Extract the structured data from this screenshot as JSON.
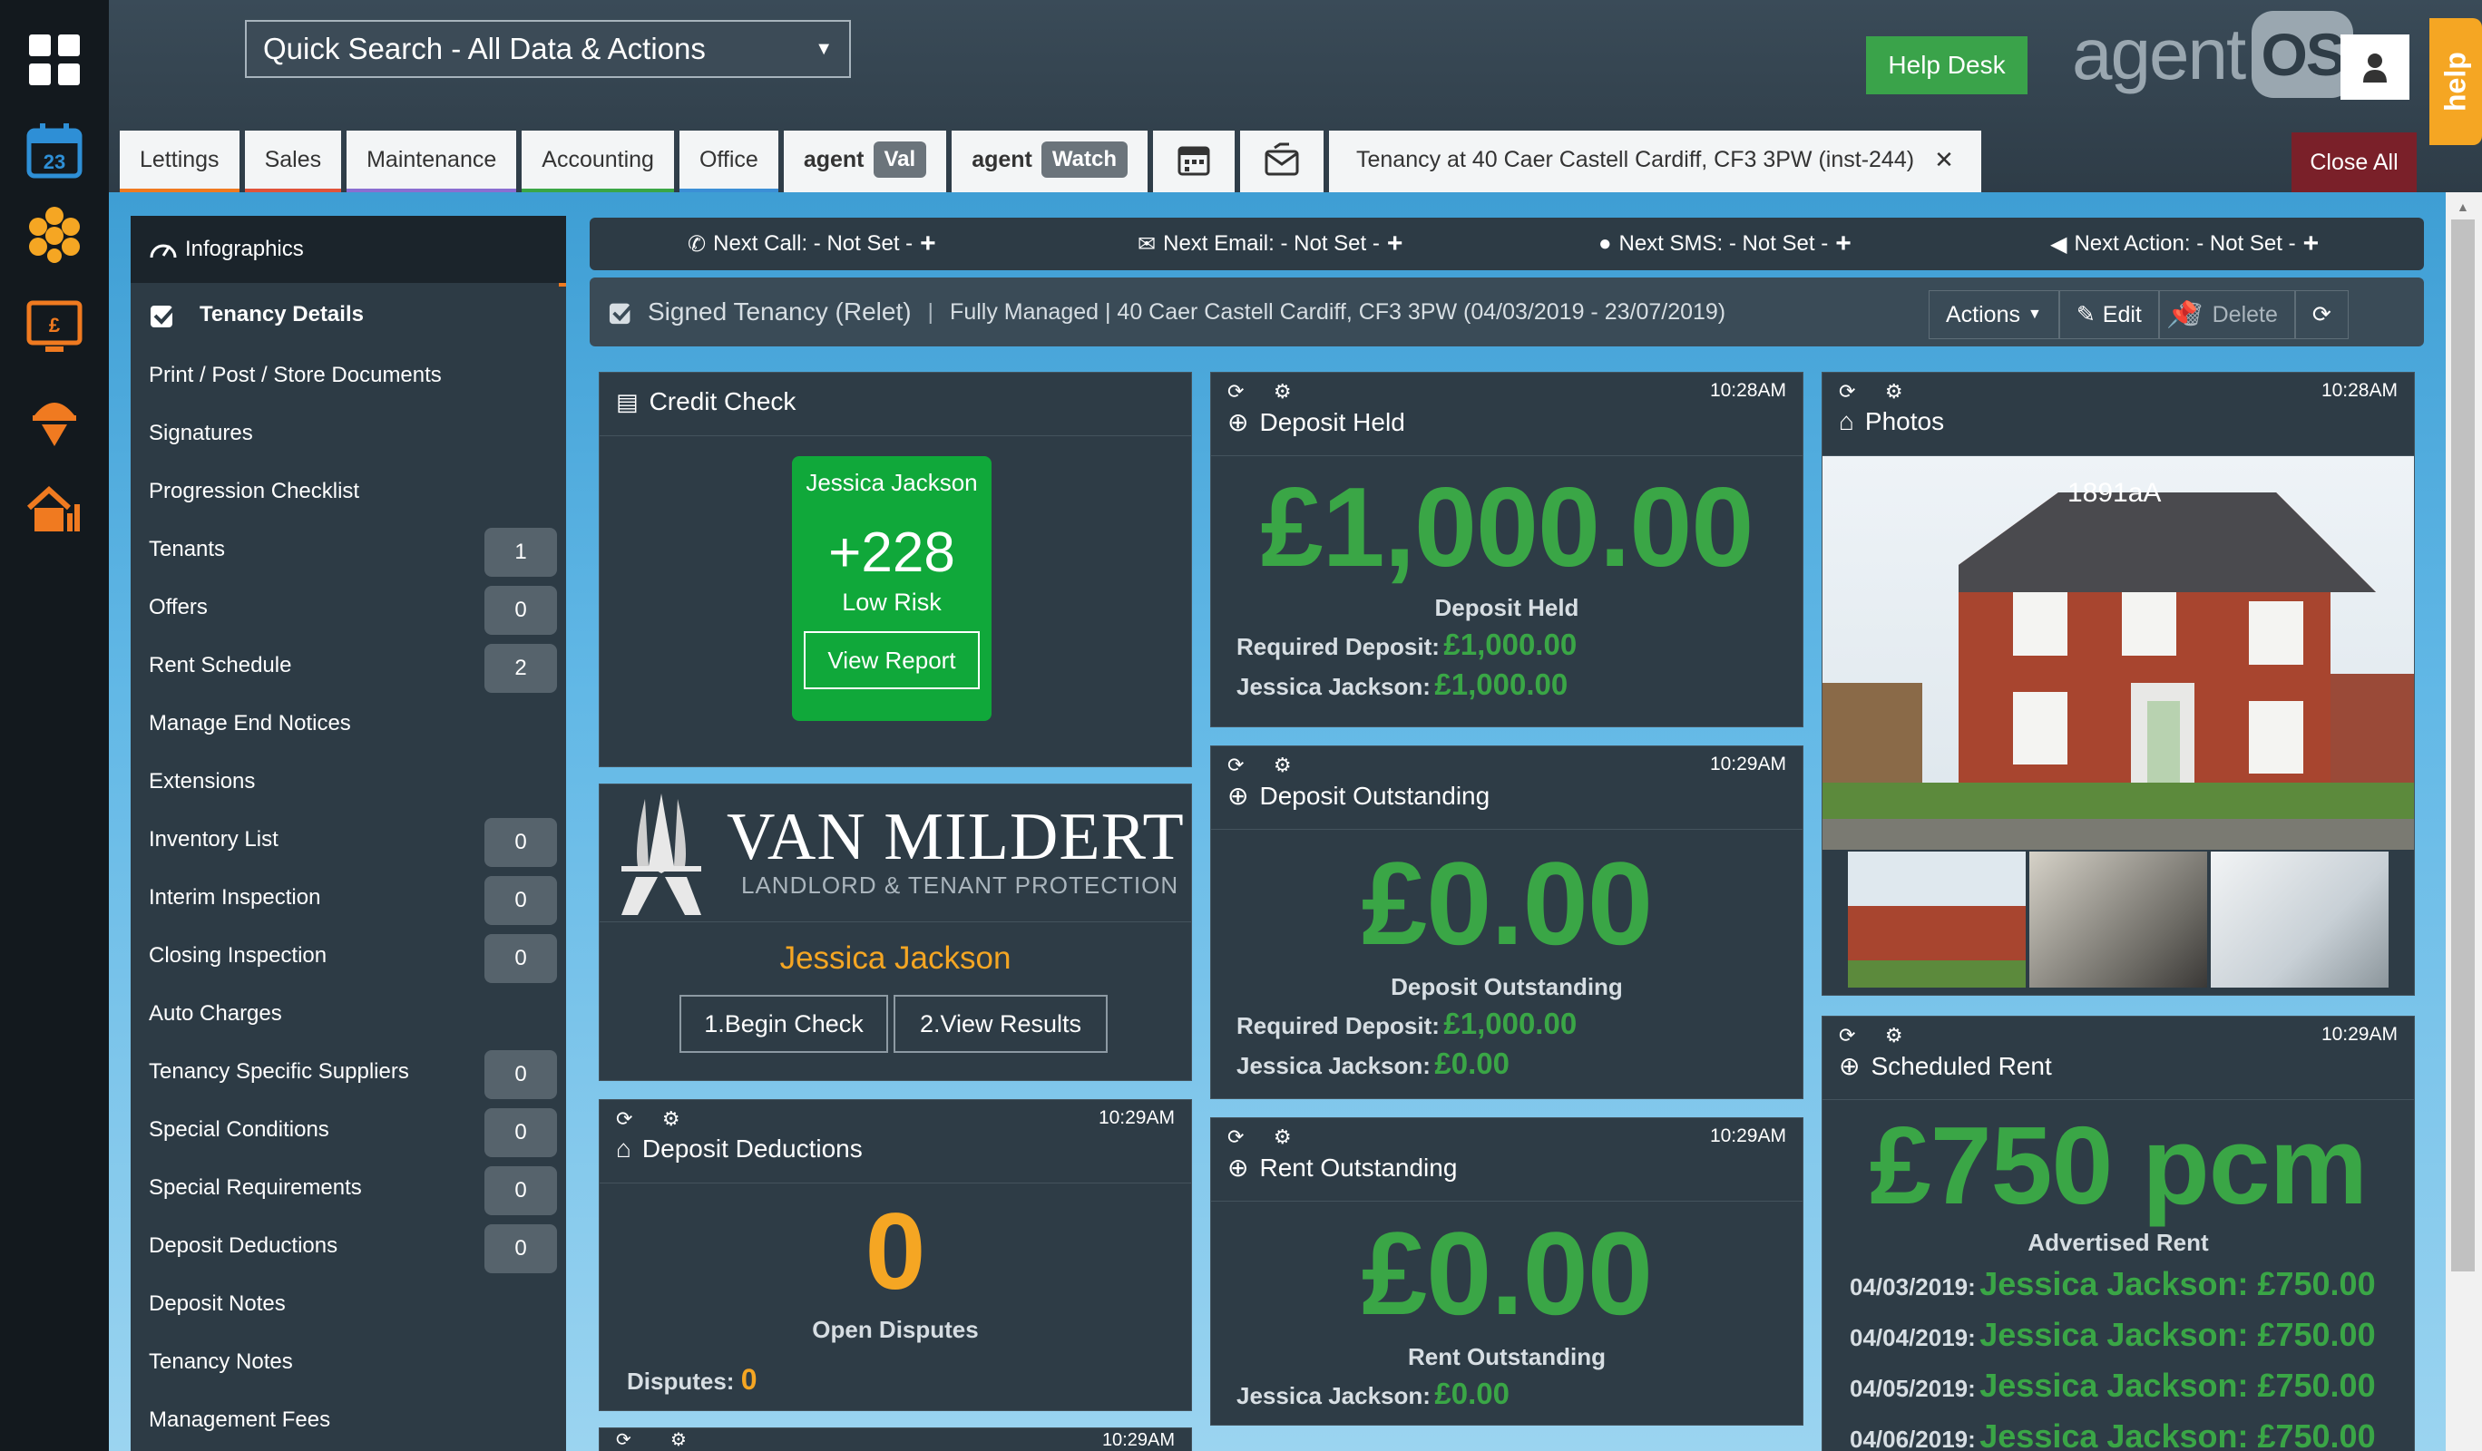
{
  "search": {
    "placeholder": "Quick Search - All Data & Actions"
  },
  "header": {
    "help_desk": "Help Desk",
    "logo_text": "agent",
    "logo_os": "OS",
    "help_tab": "help"
  },
  "tabs": [
    {
      "label": "Lettings",
      "color": "#f07a20"
    },
    {
      "label": "Sales",
      "color": "#e0533a"
    },
    {
      "label": "Maintenance",
      "color": "#8a6ed1"
    },
    {
      "label": "Accounting",
      "color": "#3aa646"
    },
    {
      "label": "Office",
      "color": "#3b8fd6"
    },
    {
      "label": "agent",
      "pill": "Val"
    },
    {
      "label": "agent",
      "pill": "Watch"
    }
  ],
  "record_tab": "Tenancy at 40 Caer Castell Cardiff, CF3 3PW (inst-244)",
  "close_all": "Close All",
  "sidebar": {
    "items": [
      {
        "label": "Infographics"
      },
      {
        "label": "Tenancy Details"
      },
      {
        "label": "Print / Post / Store Documents"
      },
      {
        "label": "Signatures"
      },
      {
        "label": "Progression Checklist"
      },
      {
        "label": "Tenants",
        "count": "1"
      },
      {
        "label": "Offers",
        "count": "0"
      },
      {
        "label": "Rent Schedule",
        "count": "2"
      },
      {
        "label": "Manage End Notices"
      },
      {
        "label": "Extensions"
      },
      {
        "label": "Inventory List",
        "count": "0"
      },
      {
        "label": "Interim Inspection",
        "count": "0"
      },
      {
        "label": "Closing Inspection",
        "count": "0"
      },
      {
        "label": "Auto Charges"
      },
      {
        "label": "Tenancy Specific Suppliers",
        "count": "0"
      },
      {
        "label": "Special Conditions",
        "count": "0"
      },
      {
        "label": "Special Requirements",
        "count": "0"
      },
      {
        "label": "Deposit Deductions",
        "count": "0"
      },
      {
        "label": "Deposit Notes"
      },
      {
        "label": "Tenancy Notes"
      },
      {
        "label": "Management Fees"
      }
    ]
  },
  "next": {
    "call": "Next Call: - Not Set -",
    "email": "Next Email: - Not Set -",
    "sms": "Next SMS: - Not Set -",
    "action": "Next Action: - Not Set -"
  },
  "status": {
    "title": "Signed Tenancy (Relet)",
    "sep": "|",
    "detail": "Fully Managed | 40 Caer Castell Cardiff, CF3 3PW (04/03/2019 - 23/07/2019)",
    "actions": "Actions",
    "edit": "Edit",
    "delete": "Delete"
  },
  "credit_check": {
    "title": "Credit Check",
    "name": "Jessica Jackson",
    "score": "+228",
    "risk": "Low Risk",
    "view_report": "View Report"
  },
  "van_mildert": {
    "brand": "VAN MILDERT",
    "tagline": "LANDLORD & TENANT PROTECTION",
    "name": "Jessica Jackson",
    "begin": "1.Begin Check",
    "results": "2.View Results"
  },
  "deposit_deductions": {
    "time": "10:29AM",
    "title": "Deposit Deductions",
    "value": "0",
    "label": "Open Disputes",
    "disputes_label": "Disputes:",
    "disputes_value": "0"
  },
  "deposit_held": {
    "time": "10:28AM",
    "title": "Deposit Held",
    "value": "£1,000.00",
    "label": "Deposit Held",
    "required_label": "Required Deposit:",
    "required_value": "£1,000.00",
    "tenant_label": "Jessica Jackson:",
    "tenant_value": "£1,000.00"
  },
  "deposit_outstanding": {
    "time": "10:29AM",
    "title": "Deposit Outstanding",
    "value": "£0.00",
    "label": "Deposit Outstanding",
    "required_label": "Required Deposit:",
    "required_value": "£1,000.00",
    "tenant_label": "Jessica Jackson:",
    "tenant_value": "£0.00"
  },
  "rent_outstanding": {
    "time": "10:29AM",
    "title": "Rent Outstanding",
    "value": "£0.00",
    "label": "Rent Outstanding",
    "tenant_label": "Jessica Jackson:",
    "tenant_value": "£0.00"
  },
  "photos": {
    "time": "10:28AM",
    "title": "Photos",
    "caption": "1891aA"
  },
  "scheduled_rent": {
    "time": "10:29AM",
    "title": "Scheduled Rent",
    "value": "£750 pcm",
    "label": "Advertised Rent",
    "rows": [
      {
        "date": "04/03/2019:",
        "text": "Jessica Jackson: £750.00"
      },
      {
        "date": "04/04/2019:",
        "text": "Jessica Jackson: £750.00"
      },
      {
        "date": "04/05/2019:",
        "text": "Jessica Jackson: £750.00"
      },
      {
        "date": "04/06/2019:",
        "text": "Jessica Jackson: £750.00"
      }
    ]
  },
  "partial_card": {
    "time": "10:29AM"
  },
  "colors": {
    "accent_green": "#3aa646",
    "accent_orange": "#f5a623",
    "close_red": "#7a2029"
  }
}
